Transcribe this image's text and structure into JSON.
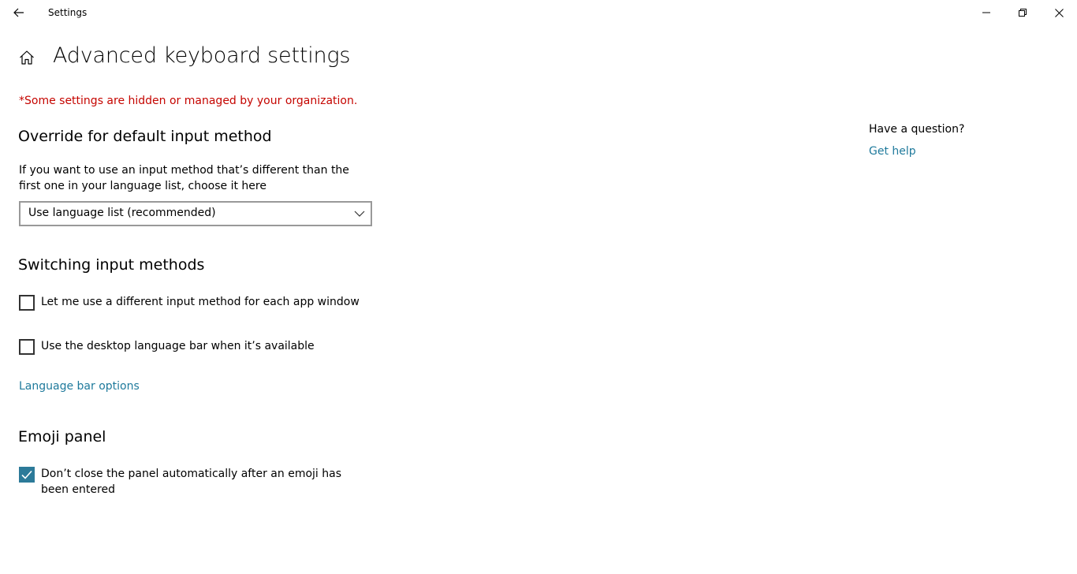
{
  "window": {
    "title": "Settings",
    "back_icon": "back-arrow-icon",
    "controls": {
      "minimize_icon": "minimize-icon",
      "restore_icon": "restore-icon",
      "close_icon": "close-icon"
    }
  },
  "page": {
    "home_icon": "home-icon",
    "title": "Advanced keyboard settings",
    "managed_note": "*Some settings are hidden or managed by your organization.",
    "managed_note_color": "#c50500"
  },
  "override_section": {
    "heading": "Override for default input method",
    "description": "If you want to use an input method that’s different than the first one in your language list, choose it here",
    "dropdown": {
      "selected": "Use language list (recommended)",
      "chevron_icon": "chevron-down-icon"
    }
  },
  "switching_section": {
    "heading": "Switching input methods",
    "checkboxes": [
      {
        "label": "Let me use a different input method for each app window",
        "checked": false
      },
      {
        "label": "Use the desktop language bar when it’s available",
        "checked": false
      }
    ],
    "link": "Language bar options"
  },
  "emoji_section": {
    "heading": "Emoji panel",
    "checkboxes": [
      {
        "label": "Don’t close the panel automatically after an emoji has been entered",
        "checked": true
      }
    ]
  },
  "side_panel": {
    "question": "Have a question?",
    "help_link": "Get help"
  },
  "colors": {
    "accent": "#2c7a99",
    "link": "#1f7a9c",
    "warning": "#c50500"
  }
}
